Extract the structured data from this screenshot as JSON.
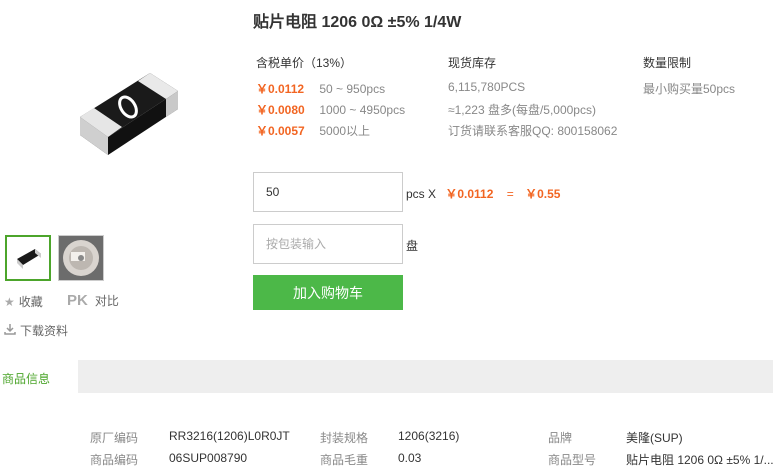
{
  "product": {
    "title": "贴片电阻 1206 0Ω ±5% 1/4W"
  },
  "side": {
    "favorite_label": "收藏",
    "pk_label": "PK",
    "compare_label": "对比",
    "download_label": "下载资料"
  },
  "pricing": {
    "header": "含税单价（13%）",
    "tiers": [
      {
        "price": "￥0.0112",
        "range": "50 ~ 950pcs"
      },
      {
        "price": "￥0.0080",
        "range": "1000 ~ 4950pcs"
      },
      {
        "price": "￥0.0057",
        "range": "5000以上"
      }
    ]
  },
  "stock": {
    "header": "现货库存",
    "qty": "6,115,780PCS",
    "reels": "≈1,223 盘多(每盘/5,000pcs)",
    "contact": "订货请联系客服QQ: 800158062"
  },
  "limit": {
    "header": "数量限制",
    "min": "最小购买量50pcs"
  },
  "order": {
    "qty_value": "50",
    "unit_label": "pcs X",
    "unit_price": "￥0.0112",
    "equals": "=",
    "total": "￥0.55",
    "pkg_placeholder": "按包装输入",
    "pkg_unit": "盘",
    "cart_button": "加入购物车"
  },
  "tabs": {
    "info_tab": "商品信息"
  },
  "specs": {
    "r1": [
      {
        "label": "原厂编码",
        "value": "RR3216(1206)L0R0JT"
      },
      {
        "label": "封装规格",
        "value": "1206(3216)"
      },
      {
        "label": "品牌",
        "value": "美隆(SUP)"
      }
    ],
    "r2": [
      {
        "label": "商品编码",
        "value": "06SUP008790"
      },
      {
        "label": "商品毛重",
        "value": "0.03"
      },
      {
        "label": "商品型号",
        "value": "贴片电阻 1206 0Ω ±5% 1/..."
      }
    ]
  },
  "colors": {
    "accent": "#4cb848",
    "price": "#f26522"
  }
}
